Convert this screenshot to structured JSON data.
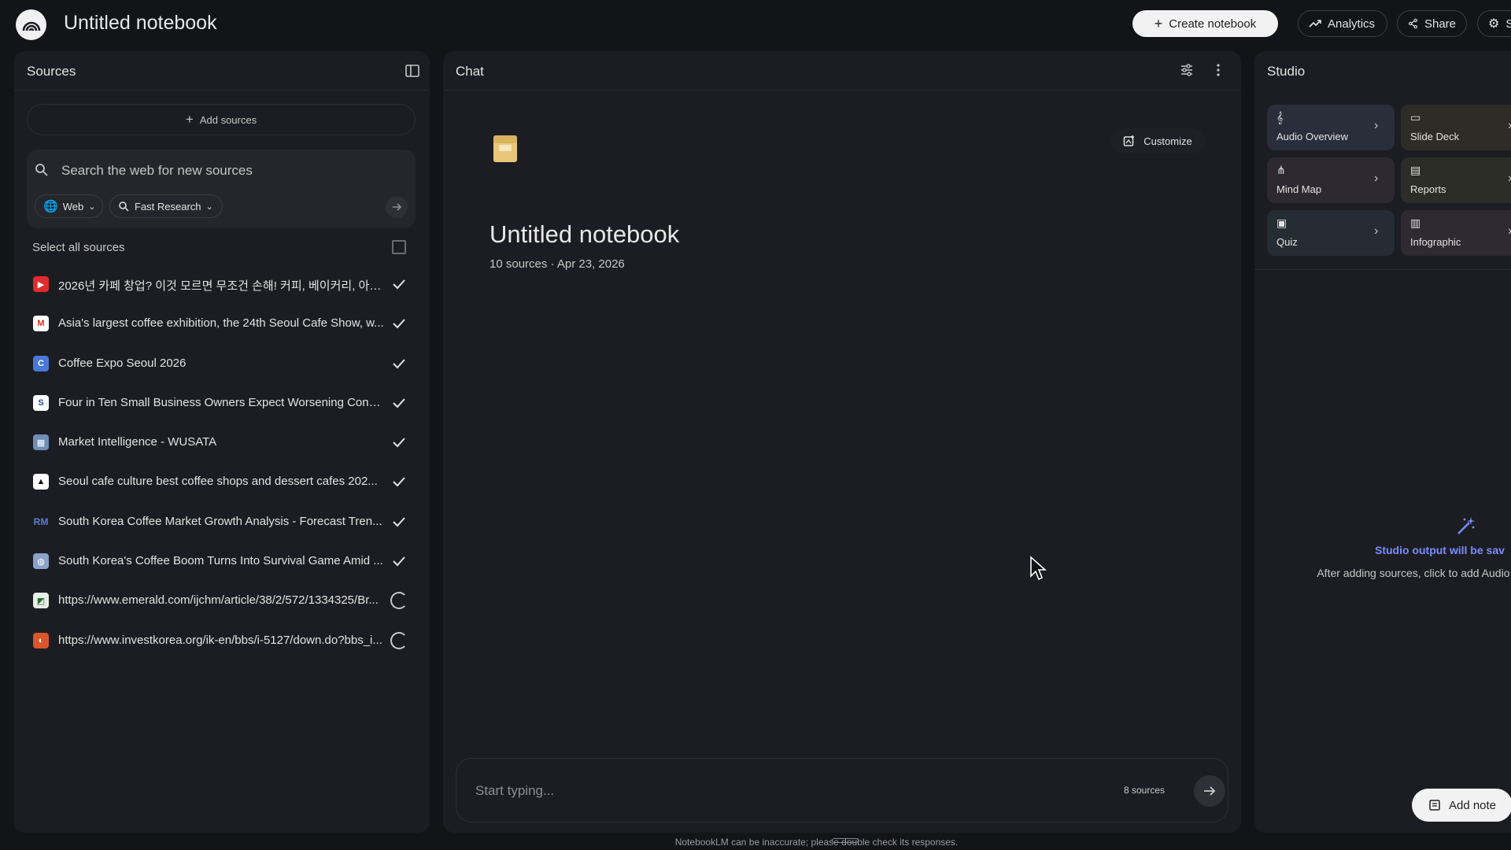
{
  "header": {
    "title": "Untitled notebook",
    "create_label": "Create notebook",
    "analytics_label": "Analytics",
    "share_label": "Share",
    "settings_label": "S"
  },
  "sources": {
    "title": "Sources",
    "add_label": "Add sources",
    "search_placeholder": "Search the web for new sources",
    "web_label": "Web",
    "research_label": "Fast Research",
    "select_all_label": "Select all sources",
    "items": [
      {
        "label": "2026년 카페 창업? 이것 모르면 무조건 손해! 커피, 베이커리, 아이스...",
        "icon": "youtube-icon",
        "status": "checked"
      },
      {
        "label": "Asia's largest coffee exhibition, the 24th Seoul Cafe Show, w...",
        "icon": "gmail-icon",
        "status": "checked"
      },
      {
        "label": "Coffee Expo Seoul 2026",
        "icon": "coffee-expo-icon",
        "status": "checked"
      },
      {
        "label": "Four in Ten Small Business Owners Expect Worsening Condi...",
        "icon": "s-logo-icon",
        "status": "checked"
      },
      {
        "label": "Market Intelligence - WUSATA",
        "icon": "flag-icon",
        "status": "checked"
      },
      {
        "label": "Seoul cafe culture best coffee shops and dessert cafes 202...",
        "icon": "triangle-logo-icon",
        "status": "checked"
      },
      {
        "label": "South Korea Coffee Market Growth Analysis - Forecast Tren...",
        "icon": "rm-logo-icon",
        "status": "checked"
      },
      {
        "label": "South Korea's Coffee Boom Turns Into Survival Game Amid ...",
        "icon": "globe-icon",
        "status": "checked"
      },
      {
        "label": "https://www.emerald.com/ijchm/article/38/2/572/1334325/Br...",
        "icon": "emerald-icon",
        "status": "loading"
      },
      {
        "label": "https://www.investkorea.org/ik-en/bbs/i-5127/down.do?bbs_i...",
        "icon": "investkorea-icon",
        "status": "loading"
      }
    ]
  },
  "chat": {
    "title": "Chat",
    "customize_label": "Customize",
    "notebook_title": "Untitled notebook",
    "notebook_meta": "10 sources · Apr 23, 2026",
    "input_placeholder": "Start typing...",
    "source_count": "8 sources"
  },
  "studio": {
    "title": "Studio",
    "tiles": [
      {
        "label": "Audio Overview",
        "icon": "audio-icon",
        "color": "#2a2d3a"
      },
      {
        "label": "Slide Deck",
        "icon": "slides-icon",
        "color": "#2d2c26"
      },
      {
        "label": "Mind Map",
        "icon": "mind-map-icon",
        "color": "#2e2930"
      },
      {
        "label": "Reports",
        "icon": "reports-icon",
        "color": "#2c2d26"
      },
      {
        "label": "Quiz",
        "icon": "quiz-icon",
        "color": "#262c33"
      },
      {
        "label": "Infographic",
        "icon": "infographic-icon",
        "color": "#2d2a31"
      }
    ],
    "empty_title": "Studio output will be sav",
    "empty_desc": "After adding sources, click to add Audio Overv and more!",
    "add_note_label": "Add note"
  },
  "footer": {
    "text": "NotebookLM can be inaccurate; please double check its responses."
  },
  "colors": {
    "background": "#131418",
    "panel": "#1c1d22",
    "accent": "#7b8cff"
  }
}
